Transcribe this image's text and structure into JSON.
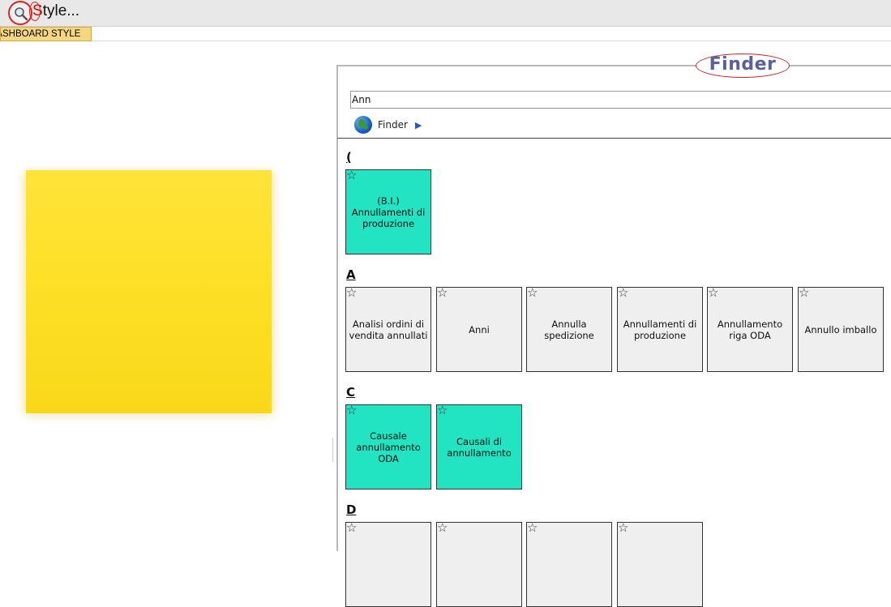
{
  "toolbar": {
    "style_first_letter": "S",
    "style_rest": "tyle...",
    "tab_label": "DASHBOARD STYLE"
  },
  "finder": {
    "title": "Finder",
    "search_value": "Ann",
    "breadcrumb": "Finder",
    "groups": [
      {
        "letter": "(",
        "items": [
          {
            "label": "(B.I.) Annullamenti di produzione",
            "color": "#22e4c2"
          }
        ]
      },
      {
        "letter": "A",
        "items": [
          {
            "label": "Analisi ordini di vendita annullati",
            "color": "#efefef"
          },
          {
            "label": "Anni",
            "color": "#efefef"
          },
          {
            "label": "Annulla spedizione",
            "color": "#efefef"
          },
          {
            "label": "Annullamenti di produzione",
            "color": "#efefef"
          },
          {
            "label": "Annullamento riga ODA",
            "color": "#efefef"
          },
          {
            "label": "Annullo imballo",
            "color": "#efefef"
          }
        ]
      },
      {
        "letter": "C",
        "items": [
          {
            "label": "Causale annullamento ODA",
            "color": "#22e4c2"
          },
          {
            "label": "Causali di annullamento",
            "color": "#22e4c2"
          }
        ]
      },
      {
        "letter": "D",
        "items": [
          {
            "label": "",
            "color": "#efefef"
          },
          {
            "label": "",
            "color": "#efefef"
          },
          {
            "label": "",
            "color": "#efefef"
          },
          {
            "label": "",
            "color": "#efefef"
          }
        ]
      }
    ]
  },
  "icons": {
    "search": "magnifier-icon",
    "star": "star-outline-icon",
    "globe": "globe-icon",
    "arrow": "play-arrow-icon"
  },
  "colors": {
    "accent_red": "#dd2222",
    "card_green": "#22e4c2",
    "card_grey": "#efefef",
    "postit_yellow": "#fde027",
    "finder_title": "#5a5fa0",
    "tab_bg": "#f6d780"
  }
}
